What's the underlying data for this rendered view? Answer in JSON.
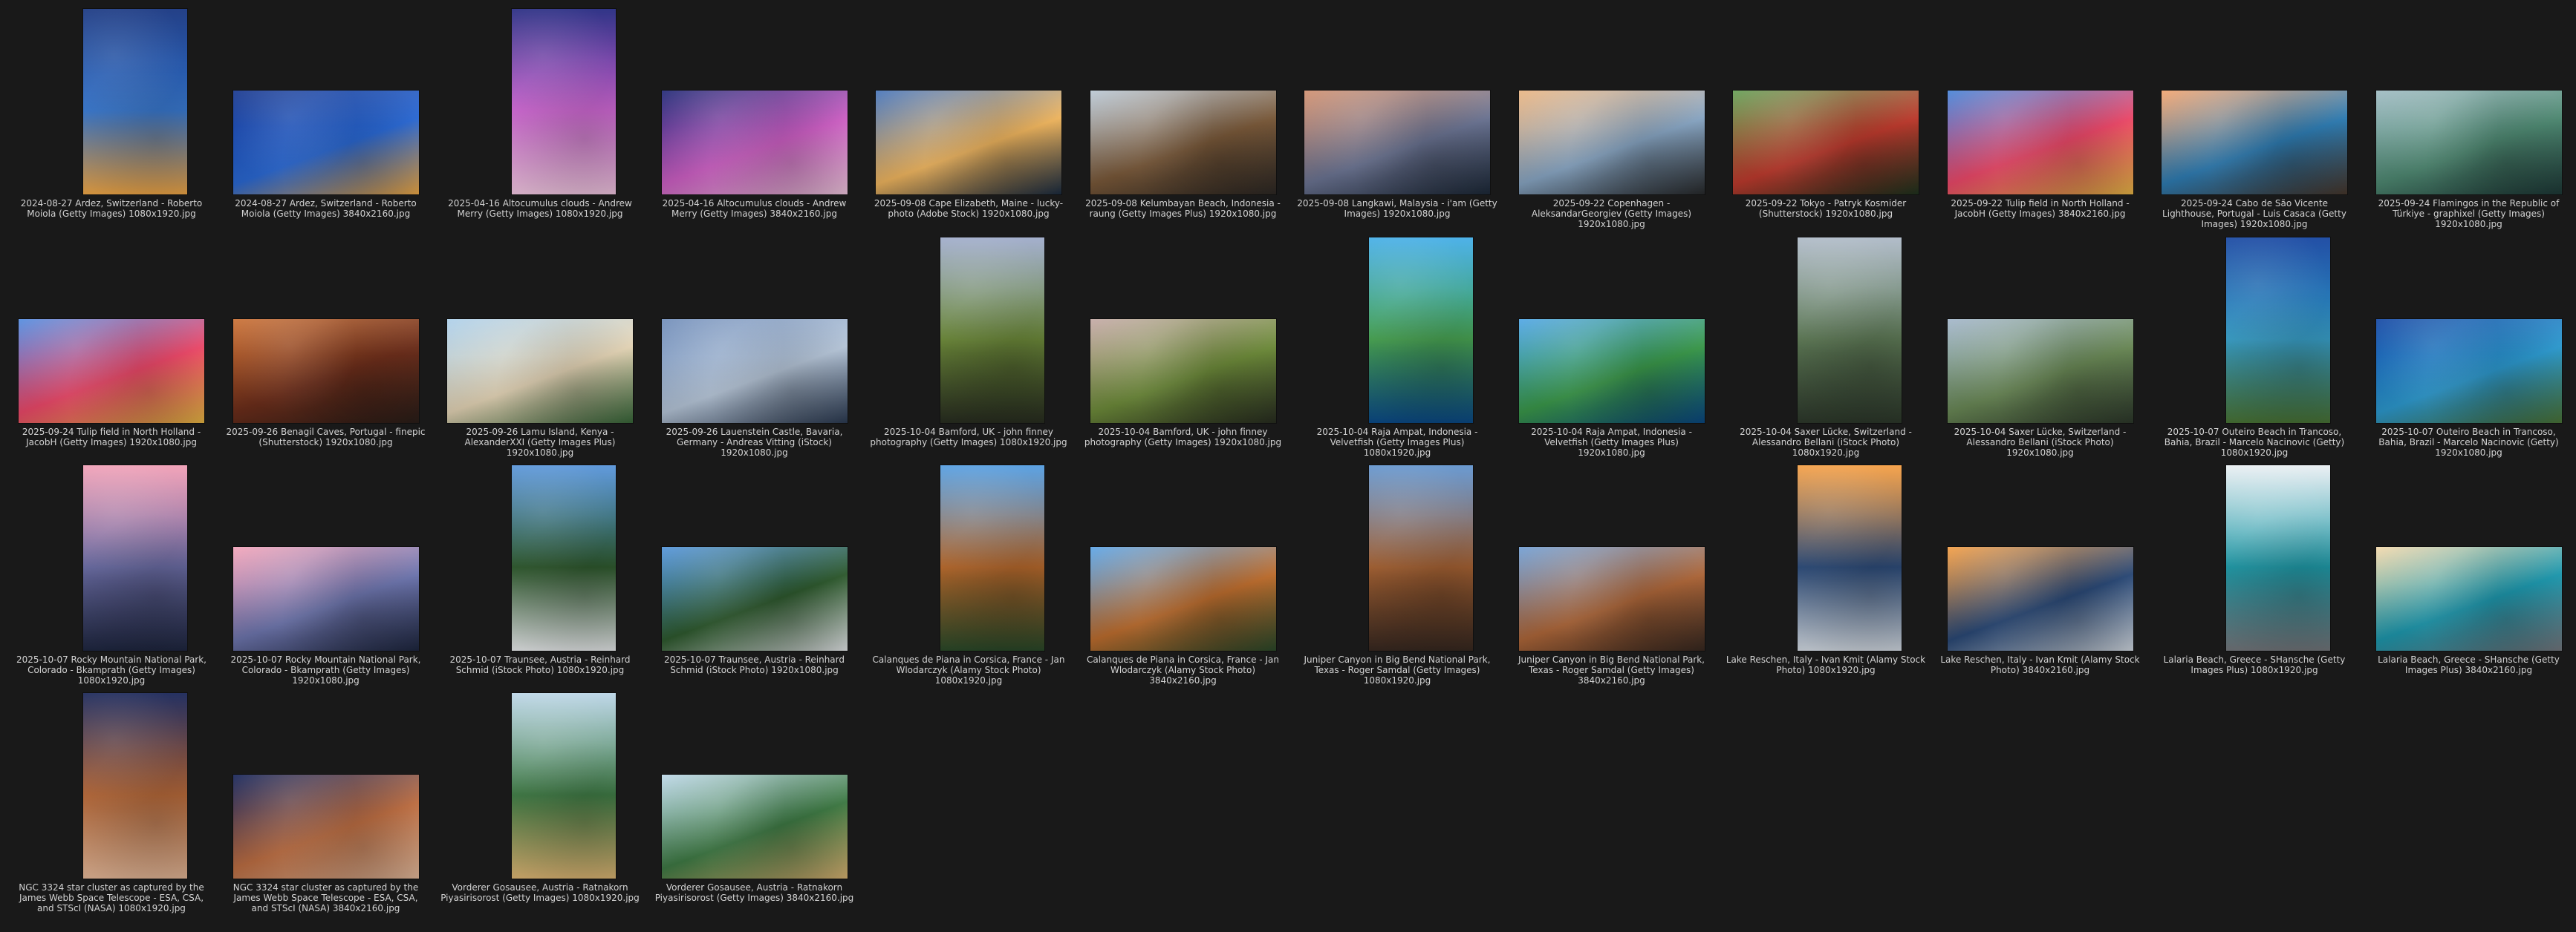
{
  "files": [
    {
      "caption": "2024-08-27 Ardez, Switzerland - Roberto Moiola (Getty Images) 1080x1920.jpg",
      "orientation": "portrait",
      "colors": [
        "#0b2b7a",
        "#3a7ad1",
        "#ffb14a"
      ]
    },
    {
      "caption": "2024-08-27 Ardez, Switzerland - Roberto Moiola (Getty Images) 3840x2160.jpg",
      "orientation": "landscape",
      "colors": [
        "#0e2f8a",
        "#2b6ad6",
        "#ffb449"
      ]
    },
    {
      "caption": "2025-04-16 Altocumulus clouds - Andrew Merry (Getty Images) 1080x1920.jpg",
      "orientation": "portrait",
      "colors": [
        "#1a1e7a",
        "#d26ad6",
        "#ffd2ee"
      ]
    },
    {
      "caption": "2025-04-16 Altocumulus clouds - Andrew Merry (Getty Images) 3840x2160.jpg",
      "orientation": "landscape",
      "colors": [
        "#182070",
        "#d061c7",
        "#ffd3ec"
      ]
    },
    {
      "caption": "2025-09-08 Cape Elizabeth, Maine - lucky-photo (Adobe Stock) 1920x1080.jpg",
      "orientation": "landscape",
      "colors": [
        "#3f6fb7",
        "#f3b860",
        "#1c2e44"
      ]
    },
    {
      "caption": "2025-09-08 Kelumbayan Beach, Indonesia - raung (Getty Images Plus) 1920x1080.jpg",
      "orientation": "landscape",
      "colors": [
        "#b8c6d3",
        "#7b5a3a",
        "#2f2a26"
      ]
    },
    {
      "caption": "2025-09-08 Langkawi, Malaysia - i'am (Getty Images) 1920x1080.jpg",
      "orientation": "landscape",
      "colors": [
        "#cf8c6a",
        "#6c7594",
        "#1e2b3b"
      ]
    },
    {
      "caption": "2025-09-22 Copenhagen - AleksandarGeorgiev (Getty Images) 1920x1080.jpg",
      "orientation": "landscape",
      "colors": [
        "#e9b27d",
        "#8aa8c6",
        "#2a2c2e"
      ]
    },
    {
      "caption": "2025-09-22 Tokyo - Patryk Kosmider (Shutterstock) 1920x1080.jpg",
      "orientation": "landscape",
      "colors": [
        "#5f9b4e",
        "#c03b2e",
        "#20361f"
      ]
    },
    {
      "caption": "2025-09-22 Tulip field in North Holland - JacobH (Getty Images) 3840x2160.jpg",
      "orientation": "landscape",
      "colors": [
        "#3f7fd6",
        "#f04a6b",
        "#f7c24a"
      ]
    },
    {
      "caption": "2025-09-24 Cabo de São Vicente Lighthouse, Portugal - Luis Casaca (Getty Images) 1920x1080.jpg",
      "orientation": "landscape",
      "colors": [
        "#f2a16a",
        "#2f7eb5",
        "#4b3a2e"
      ]
    },
    {
      "caption": "2025-09-24 Flamingos in the Republic of Türkiye - graphixel (Getty Images) 1920x1080.jpg",
      "orientation": "landscape",
      "colors": [
        "#9bb8c0",
        "#4f8a73",
        "#1f3c3a"
      ]
    },
    {
      "caption": "2025-09-24 Tulip field in North Holland - JacobH (Getty Images) 1920x1080.jpg",
      "orientation": "landscape",
      "colors": [
        "#4b87de",
        "#f04a6b",
        "#f6c247"
      ]
    },
    {
      "caption": "2025-09-26 Benagil Caves, Portugal - finepic (Shutterstock) 1920x1080.jpg",
      "orientation": "landscape",
      "colors": [
        "#c86a2c",
        "#6d2e1b",
        "#2c1f1a"
      ]
    },
    {
      "caption": "2025-09-26 Lamu Island, Kenya - AlexanderXXI (Getty Images Plus) 1920x1080.jpg",
      "orientation": "landscape",
      "colors": [
        "#a9cde9",
        "#e7d7b8",
        "#3b6d3c"
      ]
    },
    {
      "caption": "2025-09-26 Lauenstein Castle, Bavaria, Germany - Andreas Vitting (iStock) 1920x1080.jpg",
      "orientation": "landscape",
      "colors": [
        "#6a88b6",
        "#b8c8db",
        "#2e3e57"
      ]
    },
    {
      "caption": "2025-10-04 Bamford, UK - john finney photography (Getty Images) 1080x1920.jpg",
      "orientation": "portrait",
      "colors": [
        "#9aa7c8",
        "#6d8a3a",
        "#2a2f22"
      ]
    },
    {
      "caption": "2025-10-04 Bamford, UK - john finney photography (Getty Images) 1920x1080.jpg",
      "orientation": "landscape",
      "colors": [
        "#c2a6a2",
        "#6f8d3b",
        "#2a2f22"
      ]
    },
    {
      "caption": "2025-10-04 Raja Ampat, Indonesia - Velvetfish (Getty Images Plus) 1080x1920.jpg",
      "orientation": "portrait",
      "colors": [
        "#3aa9e6",
        "#49a553",
        "#0b4e8f"
      ]
    },
    {
      "caption": "2025-10-04 Raja Ampat, Indonesia - Velvetfish (Getty Images Plus) 1920x1080.jpg",
      "orientation": "landscape",
      "colors": [
        "#49a2e4",
        "#3b9a4b",
        "#0a4c8a"
      ]
    },
    {
      "caption": "2025-10-04 Saxer Lücke, Switzerland - Alessandro Bellani (iStock Photo) 1080x1920.jpg",
      "orientation": "portrait",
      "colors": [
        "#aab6c4",
        "#5f7b57",
        "#2f3b2d"
      ]
    },
    {
      "caption": "2025-10-04 Saxer Lücke, Switzerland - Alessandro Bellani (iStock Photo) 1920x1080.jpg",
      "orientation": "landscape",
      "colors": [
        "#9fb3c8",
        "#6b8a57",
        "#2f3b2d"
      ]
    },
    {
      "caption": "2025-10-07 Outeiro Beach in Trancoso, Bahia, Brazil - Marcelo Nacinovic (Getty) 1080x1920.jpg",
      "orientation": "portrait",
      "colors": [
        "#0a3c9c",
        "#39a0c9",
        "#4d7a38"
      ]
    },
    {
      "caption": "2025-10-07 Outeiro Beach in Trancoso, Bahia, Brazil - Marcelo Nacinovic (Getty) 1920x1080.jpg",
      "orientation": "landscape",
      "colors": [
        "#0b40a0",
        "#2d9bd1",
        "#4f7b3a"
      ]
    },
    {
      "caption": "2025-10-07 Rocky Mountain National Park, Colorado - Bkamprath (Getty Images) 1080x1920.jpg",
      "orientation": "portrait",
      "colors": [
        "#f09ab2",
        "#6a6ca4",
        "#202843"
      ]
    },
    {
      "caption": "2025-10-07 Rocky Mountain National Park, Colorado - Bkamprath (Getty Images) 1920x1080.jpg",
      "orientation": "landscape",
      "colors": [
        "#f2a0b6",
        "#6f77b0",
        "#1f2842"
      ]
    },
    {
      "caption": "2025-10-07 Traunsee, Austria - Reinhard Schmid (iStock Photo) 1080x1920.jpg",
      "orientation": "portrait",
      "colors": [
        "#4f8fd8",
        "#2f5a2e",
        "#f4f7f8"
      ]
    },
    {
      "caption": "2025-10-07 Traunsee, Austria - Reinhard Schmid (iStock Photo) 1920x1080.jpg",
      "orientation": "landscape",
      "colors": [
        "#4c90d9",
        "#2f5b2f",
        "#f2f5f7"
      ]
    },
    {
      "caption": "Calanques de Piana in Corsica, France - Jan Wlodarczyk (Alamy Stock Photo) 1080x1920.jpg",
      "orientation": "portrait",
      "colors": [
        "#4a98e0",
        "#b7692c",
        "#2c4d2b"
      ]
    },
    {
      "caption": "Calanques de Piana in Corsica, France - Jan Wlodarczyk (Alamy Stock Photo) 3840x2160.jpg",
      "orientation": "landscape",
      "colors": [
        "#55a1e6",
        "#c06f2f",
        "#2d4d2c"
      ]
    },
    {
      "caption": "Juniper Canyon in Big Bend National Park, Texas - Roger Samdal (Getty Images) 1080x1920.jpg",
      "orientation": "portrait",
      "colors": [
        "#5a8fcc",
        "#a66233",
        "#3a2a22"
      ]
    },
    {
      "caption": "Juniper Canyon in Big Bend National Park, Texas - Roger Samdal (Getty Images) 3840x2160.jpg",
      "orientation": "landscape",
      "colors": [
        "#6b9ad1",
        "#b0683a",
        "#3a2a22"
      ]
    },
    {
      "caption": "Lake Reschen, Italy - Ivan Kmit (Alamy Stock Photo) 1080x1920.jpg",
      "orientation": "portrait",
      "colors": [
        "#f59a3a",
        "#2d4c7a",
        "#dfe7f0"
      ]
    },
    {
      "caption": "Lake Reschen, Italy - Ivan Kmit (Alamy Stock Photo) 3840x2160.jpg",
      "orientation": "landscape",
      "colors": [
        "#f39a3d",
        "#2b4a78",
        "#dfe7f0"
      ]
    },
    {
      "caption": "Lalaria Beach, Greece - SHansche (Getty Images Plus) 1080x1920.jpg",
      "orientation": "portrait",
      "colors": [
        "#e9eef2",
        "#1f9aa8",
        "#7a7d82"
      ]
    },
    {
      "caption": "Lalaria Beach, Greece - SHansche (Getty Images Plus) 3840x2160.jpg",
      "orientation": "landscape",
      "colors": [
        "#f3d7a8",
        "#1e9ab0",
        "#7b7f86"
      ]
    },
    {
      "caption": "NGC 3324 star cluster as captured by the James Webb Space Telescope - ESA, CSA, and STScI (NASA) 1080x1920.jpg",
      "orientation": "portrait",
      "colors": [
        "#0d1a4f",
        "#b86a3a",
        "#f2c2a0"
      ]
    },
    {
      "caption": "NGC 3324 star cluster as captured by the James Webb Space Telescope - ESA, CSA, and STScI (NASA) 3840x2160.jpg",
      "orientation": "landscape",
      "colors": [
        "#0c1b52",
        "#c07044",
        "#f3c6a6"
      ]
    },
    {
      "caption": "Vorderer Gosausee, Austria - Ratnakorn Piyasirisorost (Getty Images) 1080x1920.jpg",
      "orientation": "portrait",
      "colors": [
        "#b8d4e6",
        "#3f7b45",
        "#e9c07a"
      ]
    },
    {
      "caption": "Vorderer Gosausee, Austria - Ratnakorn Piyasirisorost (Getty Images) 3840x2160.jpg",
      "orientation": "landscape",
      "colors": [
        "#bad6e7",
        "#3f7b45",
        "#e6be79"
      ]
    }
  ]
}
